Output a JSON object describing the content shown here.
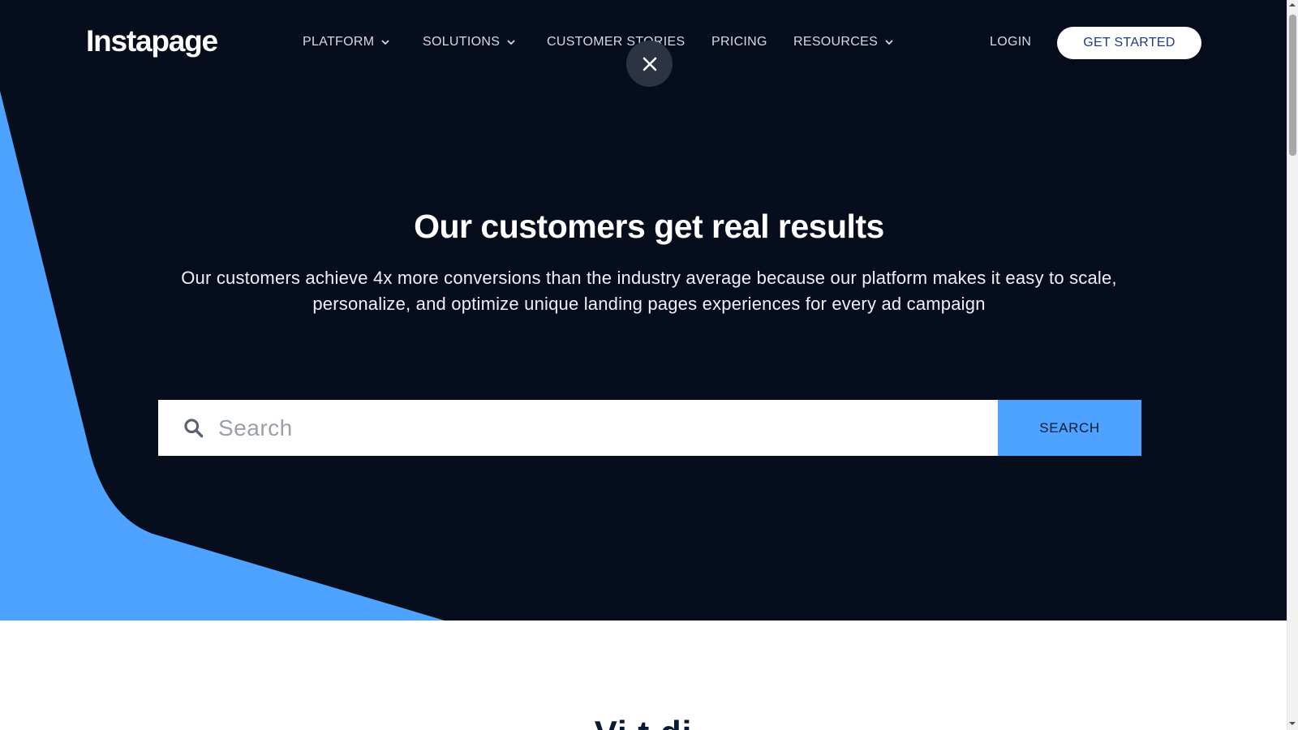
{
  "brand": {
    "name": "Instapage"
  },
  "nav": {
    "items": [
      {
        "label": "PLATFORM",
        "has_dropdown": true
      },
      {
        "label": "SOLUTIONS",
        "has_dropdown": true
      },
      {
        "label": "CUSTOMER STORIES",
        "has_dropdown": false
      },
      {
        "label": "PRICING",
        "has_dropdown": false
      },
      {
        "label": "RESOURCES",
        "has_dropdown": true
      }
    ],
    "login_label": "LOGIN",
    "cta_label": "GET STARTED"
  },
  "overlay": {
    "close_icon": "close-icon"
  },
  "hero": {
    "headline": "Our customers get real results",
    "subhead": "Our customers achieve 4x more conversions than the industry average because our platform makes it easy to scale, personalize, and optimize unique landing pages experiences for every ad campaign"
  },
  "search": {
    "placeholder": "Search",
    "value": "",
    "button_label": "SEARCH",
    "icon": "search-icon"
  },
  "next_section": {
    "title_partial": "Vi          t  di"
  },
  "colors": {
    "hero_bg": "#060d1c",
    "accent_blue": "#4da3ff",
    "cta_text": "#1e3a8a",
    "white": "#ffffff"
  }
}
